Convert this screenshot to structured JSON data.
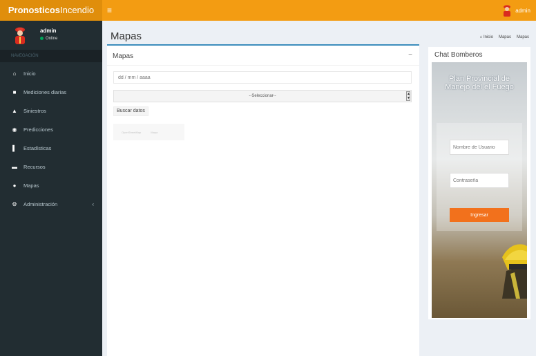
{
  "header": {
    "brand_bold": "Pronosticos",
    "brand_light": "Incendio",
    "user_name": "admin"
  },
  "sidebar": {
    "user_name": "admin",
    "user_status": "Online",
    "section_label": "NAVEGACIÓN",
    "items": [
      {
        "label": "Inicio",
        "icon": "home-icon"
      },
      {
        "label": "Mediciones diarias",
        "icon": "database-icon"
      },
      {
        "label": "Siniestros",
        "icon": "fire-icon"
      },
      {
        "label": "Predicciones",
        "icon": "eye-icon"
      },
      {
        "label": "Estadísticas",
        "icon": "bar-chart-icon"
      },
      {
        "label": "Recursos",
        "icon": "truck-icon"
      },
      {
        "label": "Mapas",
        "icon": "globe-icon"
      },
      {
        "label": "Administración",
        "icon": "gear-icon"
      }
    ]
  },
  "page": {
    "title": "Mapas",
    "breadcrumb": [
      "Inicio",
      "Mapas",
      "Mapas"
    ]
  },
  "main_box": {
    "title": "Mapas",
    "collapse_symbol": "−",
    "date_placeholder": "dd / mm / aaaa",
    "select_value": "--Seleccionar--",
    "search_label": "Buscar datos",
    "map_controls": [
      "OpenStreetMap",
      "Mapa"
    ]
  },
  "chat_box": {
    "title": "Chat Bomberos",
    "login_title": "Plan Provincial de Manejo del el Fuego",
    "username_placeholder": "Nombre de Usuario",
    "password_placeholder": "Contraseña",
    "submit_label": "Ingresar"
  },
  "colors": {
    "header": "#f39c12",
    "brand": "#e08e0b",
    "sidebar": "#222d32",
    "accent": "#3c8dbc",
    "button": "#f2711c"
  }
}
